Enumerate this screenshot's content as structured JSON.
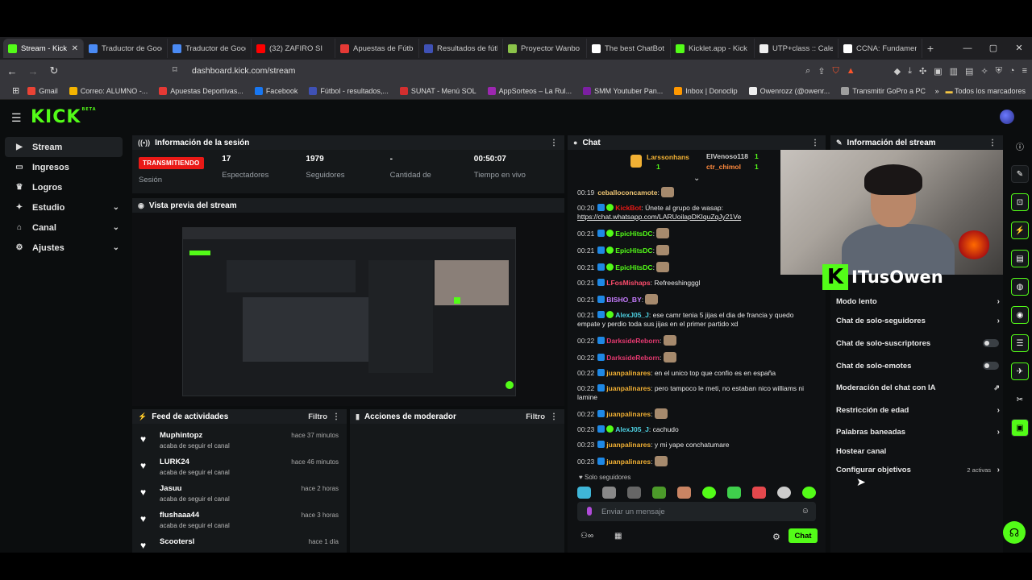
{
  "browser": {
    "tabs": [
      {
        "title": "Stream - Kick",
        "color": "#53fc18",
        "active": true
      },
      {
        "title": "Traductor de Goog",
        "color": "#4a8af4"
      },
      {
        "title": "Traductor de Goog",
        "color": "#4a8af4"
      },
      {
        "title": "(32) ZAFIRO SI",
        "color": "#ff0000"
      },
      {
        "title": "Apuestas de Fútbo",
        "color": "#e53935"
      },
      {
        "title": "Resultados de fútb",
        "color": "#3f51b5"
      },
      {
        "title": "Proyector Wanbo",
        "color": "#8bc34a"
      },
      {
        "title": "The best ChatBot",
        "color": "#ffffff"
      },
      {
        "title": "Kicklet.app - Kick",
        "color": "#53fc18"
      },
      {
        "title": "UTP+class :: Calen",
        "color": "#eeeeee"
      },
      {
        "title": "CCNA: Fundamen",
        "color": "#ffffff"
      }
    ],
    "url": "dashboard.kick.com/stream",
    "bookmarks": [
      {
        "label": "Gmail",
        "color": "#ea4335"
      },
      {
        "label": "Correo: ALUMNO -...",
        "color": "#f4b400"
      },
      {
        "label": "Apuestas Deportivas...",
        "color": "#e53935"
      },
      {
        "label": "Facebook",
        "color": "#1877f2"
      },
      {
        "label": "Fútbol - resultados,...",
        "color": "#3f51b5"
      },
      {
        "label": "SUNAT - Menú SOL",
        "color": "#d32f2f"
      },
      {
        "label": "AppSorteos – La Rul...",
        "color": "#9c27b0"
      },
      {
        "label": "SMM Youtuber Pan...",
        "color": "#7b1fa2"
      },
      {
        "label": "Inbox | Donoclip",
        "color": "#ff9800"
      },
      {
        "label": "Owenrozz (@owenr...",
        "color": "#eeeeee"
      },
      {
        "label": "Transmitir GoPro a PC",
        "color": "#9e9e9e"
      }
    ],
    "all_bookmarks": "Todos los marcadores"
  },
  "sidebar": {
    "items": [
      {
        "label": "Stream",
        "icon": "video-icon"
      },
      {
        "label": "Ingresos",
        "icon": "money-icon"
      },
      {
        "label": "Logros",
        "icon": "trophy-icon"
      },
      {
        "label": "Estudio",
        "icon": "studio-icon"
      },
      {
        "label": "Canal",
        "icon": "channel-icon"
      },
      {
        "label": "Ajustes",
        "icon": "gear-icon"
      }
    ]
  },
  "session": {
    "title": "Información de la sesión",
    "live_badge": "TRANSMITIENDO",
    "live_label": "Sesión",
    "stats": [
      {
        "value": "17",
        "label": "Espectadores"
      },
      {
        "value": "1979",
        "label": "Seguidores"
      },
      {
        "value": "-",
        "label": "Cantidad de suscripciones"
      },
      {
        "value": "00:50:07",
        "label": "Tiempo en vivo"
      }
    ]
  },
  "preview": {
    "title": "Vista previa del stream"
  },
  "feed": {
    "title": "Feed de actividades",
    "filter": "Filtro",
    "items": [
      {
        "name": "Muphintopz",
        "sub": "acaba de seguir el canal",
        "time": "hace 37 minutos"
      },
      {
        "name": "LURK24",
        "sub": "acaba de seguir el canal",
        "time": "hace 46 minutos"
      },
      {
        "name": "Jasuu",
        "sub": "acaba de seguir el canal",
        "time": "hace 2 horas"
      },
      {
        "name": "flushaaa44",
        "sub": "acaba de seguir el canal",
        "time": "hace 3 horas"
      },
      {
        "name": "Scootersl",
        "sub": "",
        "time": "hace 1 día"
      }
    ]
  },
  "moderator": {
    "title": "Acciones de moderador",
    "filter": "Filtro"
  },
  "chat": {
    "title": "Chat",
    "pinned": [
      {
        "name": "Larssonhans",
        "count": "1"
      },
      {
        "name": "ElVenoso118",
        "count": "1"
      },
      {
        "name": "ctr_chimol",
        "count": "1"
      }
    ],
    "messages": [
      {
        "time": "00:19",
        "user": "ceballoconcamote",
        "color": "#f0c674",
        "text": "",
        "emote": true
      },
      {
        "time": "00:20",
        "user": "KickBot",
        "color": "#e91916",
        "text": "Únete al grupo de wasap:",
        "link": "https://chat.whatsapp.com/LARUoilapDKIquZqJy21Ve"
      },
      {
        "time": "00:21",
        "user": "EpicHitsDC",
        "color": "#53fc18",
        "text": "",
        "emote": true
      },
      {
        "time": "00:21",
        "user": "EpicHitsDC",
        "color": "#53fc18",
        "text": "",
        "emote": true
      },
      {
        "time": "00:21",
        "user": "EpicHitsDC",
        "color": "#53fc18",
        "text": "",
        "emote": true
      },
      {
        "time": "00:21",
        "user": "LFosMishaps",
        "color": "#ff4d6d",
        "text": "Refreeshingggl"
      },
      {
        "time": "00:21",
        "user": "BISHO_BY",
        "color": "#c77dff",
        "text": "",
        "emote": true
      },
      {
        "time": "00:21",
        "user": "AlexJ05_J",
        "color": "#4dd0e1",
        "text": "ese camr tenia 5 jijas el dia de francia y quedo empate y perdio toda sus jijas en el primer partido xd"
      },
      {
        "time": "00:22",
        "user": "DarksideReborn",
        "color": "#e53970",
        "text": "",
        "emote": true
      },
      {
        "time": "00:22",
        "user": "DarksideReborn",
        "color": "#e53970",
        "text": "",
        "emote": true
      },
      {
        "time": "00:22",
        "user": "juanpalinares",
        "color": "#f2b134",
        "text": "en el unico top que confio es en españa"
      },
      {
        "time": "00:22",
        "user": "juanpalinares",
        "color": "#f2b134",
        "text": "pero tampoco le meti, no estaban nico williams ni lamine"
      },
      {
        "time": "00:22",
        "user": "juanpalinares",
        "color": "#f2b134",
        "text": "",
        "emote": true
      },
      {
        "time": "00:23",
        "user": "AlexJ05_J",
        "color": "#4dd0e1",
        "text": "cachudo"
      },
      {
        "time": "00:23",
        "user": "juanpalinares",
        "color": "#f2b134",
        "text": "y mi yape conchatumare"
      },
      {
        "time": "00:23",
        "user": "juanpalinares",
        "color": "#f2b134",
        "text": "",
        "emote": true
      }
    ],
    "followers_only": "Solo seguidores",
    "input_placeholder": "Enviar un mensaje",
    "send_button": "Chat"
  },
  "stream_info": {
    "title": "Información del stream",
    "streamer_name": "ITusOwen",
    "rows": [
      {
        "label": "Modo lento",
        "control": "chevron"
      },
      {
        "label": "Chat de solo-seguidores",
        "control": "chevron"
      },
      {
        "label": "Chat de solo-suscriptores",
        "control": "toggle"
      },
      {
        "label": "Chat de solo-emotes",
        "control": "toggle"
      },
      {
        "label": "Moderación del chat con IA",
        "control": "external"
      },
      {
        "label": "Restricción de edad",
        "control": "chevron"
      },
      {
        "label": "Palabras baneadas",
        "control": "chevron"
      },
      {
        "label": "Hostear canal",
        "control": "none"
      },
      {
        "label": "Configurar objetivos",
        "control": "chevron",
        "extra": "2 activas"
      }
    ]
  },
  "colors": {
    "accent": "#53fc18",
    "live": "#e91916"
  }
}
